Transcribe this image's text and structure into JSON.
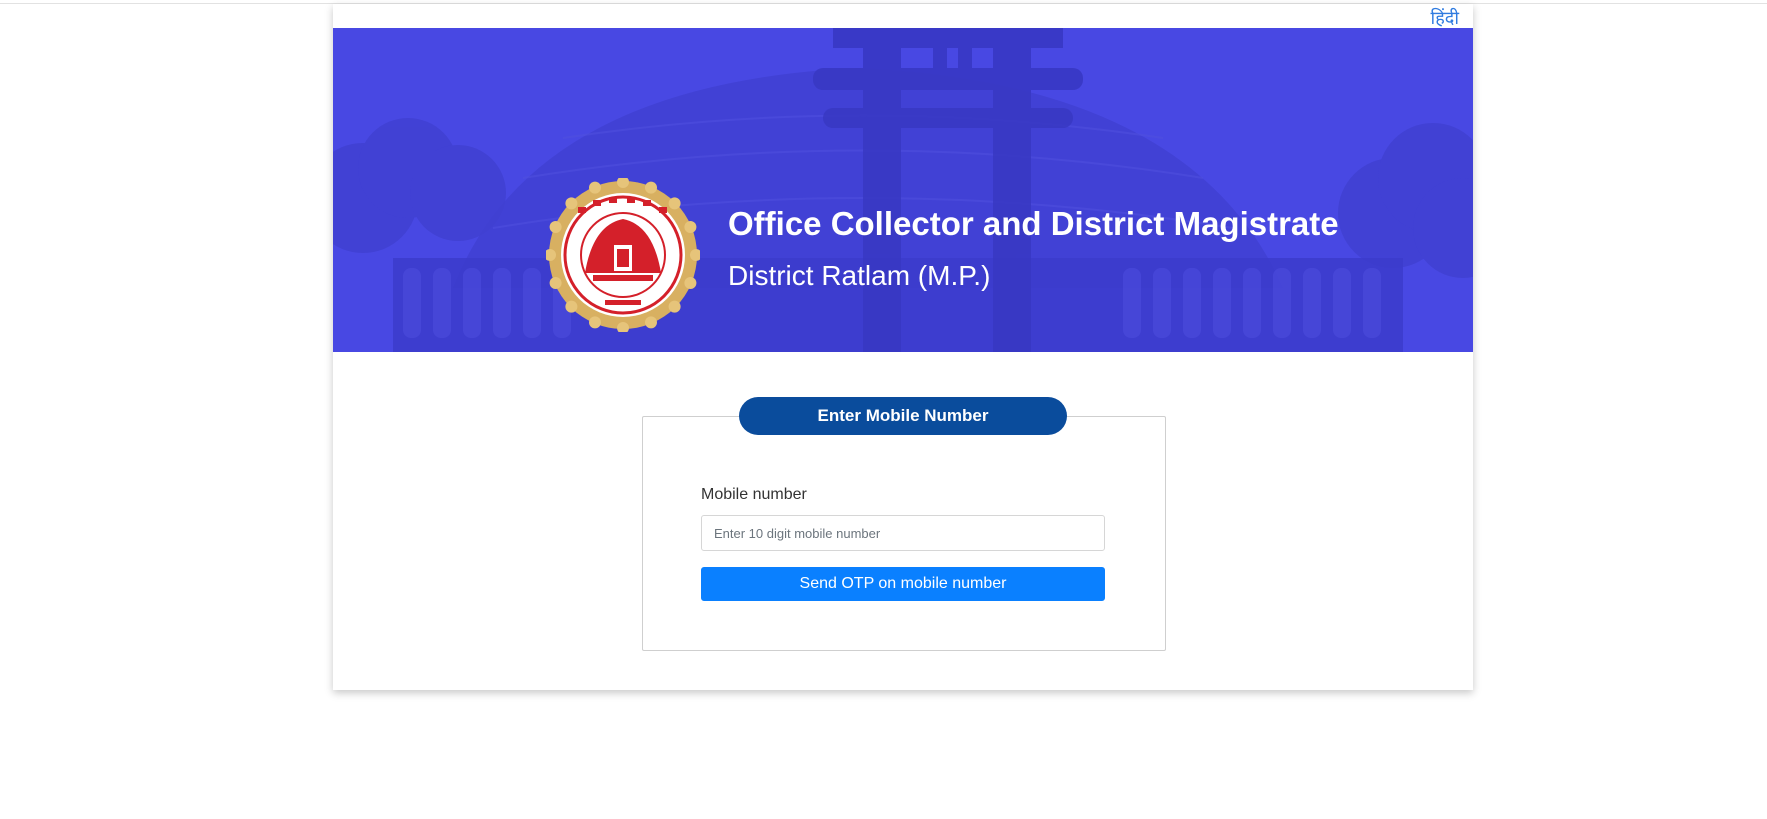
{
  "header": {
    "language_link": "हिंदी",
    "title": "Office Collector and District Magistrate",
    "subtitle": "District Ratlam (M.P.)",
    "emblem_icon": "mp-state-emblem-icon",
    "banner_color": "#4747e0"
  },
  "form": {
    "legend": "Enter Mobile Number",
    "mobile_label": "Mobile number",
    "mobile_value": "",
    "mobile_placeholder": "Enter 10 digit mobile number",
    "submit_label": "Send OTP on mobile number",
    "legend_color": "#0a4c9c",
    "button_color": "#0a80ff"
  }
}
